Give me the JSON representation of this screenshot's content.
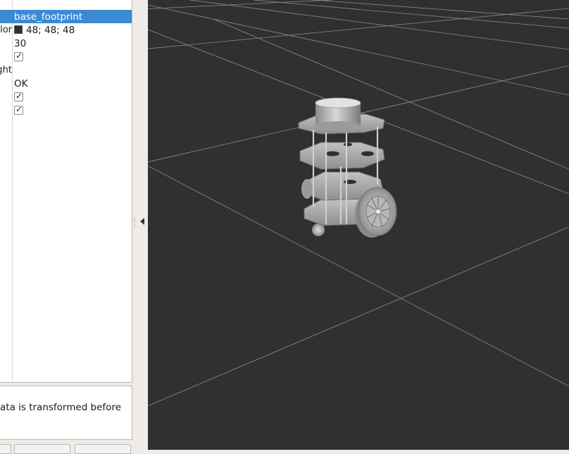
{
  "properties": {
    "rows": [
      {
        "name": "",
        "value": "base_footprint",
        "kind": "text",
        "selected": true
      },
      {
        "name": "Background Color",
        "value": "48; 48; 48",
        "kind": "color",
        "color": "#303030"
      },
      {
        "name": "",
        "value": "30",
        "kind": "text"
      },
      {
        "name": "",
        "value": "",
        "kind": "checkbox",
        "checked": true
      },
      {
        "name": "Default Light",
        "value": "",
        "kind": "label"
      },
      {
        "name": "",
        "value": "OK",
        "kind": "text"
      },
      {
        "name": "",
        "value": "",
        "kind": "checkbox",
        "checked": true
      },
      {
        "name": "",
        "value": "",
        "kind": "checkbox",
        "checked": true
      }
    ]
  },
  "description": {
    "text": "ata is transformed before"
  },
  "viewport": {
    "background_color": "#303030",
    "grid_color": "#8c8c8c",
    "model": "turtlebot-robot"
  }
}
